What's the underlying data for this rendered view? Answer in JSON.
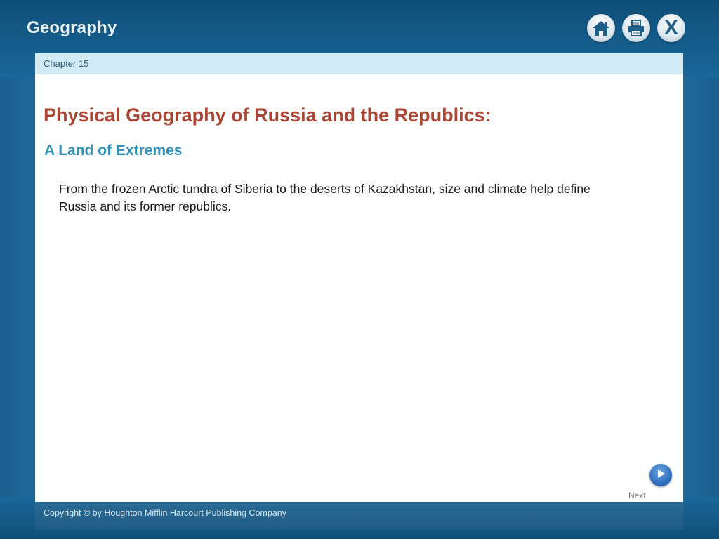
{
  "header": {
    "app_title": "Geography",
    "buttons": {
      "home_icon": "home-icon",
      "print_icon": "print-icon",
      "close_label": "X"
    }
  },
  "panel": {
    "chapter_label": "Chapter 15",
    "title": "Physical Geography of Russia and the Republics:",
    "subtitle": "A Land of Extremes",
    "body": "From the frozen Arctic tundra of Siberia to the deserts of Kazakhstan, size and climate help define Russia and its former republics."
  },
  "navigation": {
    "next_label": "Next",
    "next_icon": "play-arrow-icon"
  },
  "footer": {
    "copyright": "Copyright © by Houghton Mifflin Harcourt Publishing Company"
  },
  "colors": {
    "title": "#a94634",
    "subtitle": "#2e8fb8",
    "chapter_bar": "#d3ebf5",
    "background_blue": "#2e86bd"
  }
}
